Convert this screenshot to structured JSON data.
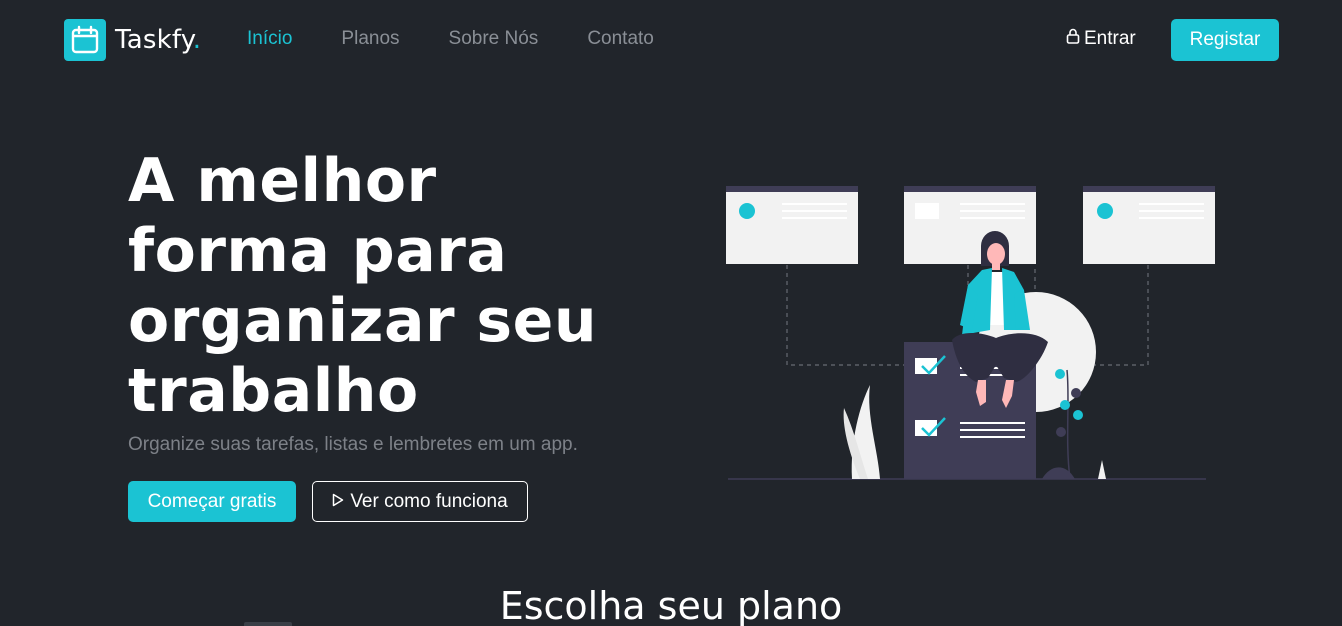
{
  "brand": {
    "name": "Taskfy",
    "dot": "."
  },
  "nav": {
    "links": [
      {
        "label": "Início",
        "active": true
      },
      {
        "label": "Planos",
        "active": false
      },
      {
        "label": "Sobre Nós",
        "active": false
      },
      {
        "label": "Contato",
        "active": false
      }
    ],
    "login_label": "Entrar",
    "register_label": "Registar"
  },
  "hero": {
    "title": "A melhor forma para organizar seu trabalho",
    "subtitle": "Organize suas tarefas, listas e lembretes em um app.",
    "primary_cta": "Começar gratis",
    "secondary_cta": "Ver como funciona"
  },
  "plans": {
    "title": "Escolha seu plano"
  },
  "colors": {
    "background": "#21252b",
    "accent": "#1bc3d3",
    "muted_text": "#8a8f96"
  },
  "icons": {
    "logo": "calendar-icon",
    "login": "lock-icon",
    "secondary_cta": "play-icon"
  }
}
